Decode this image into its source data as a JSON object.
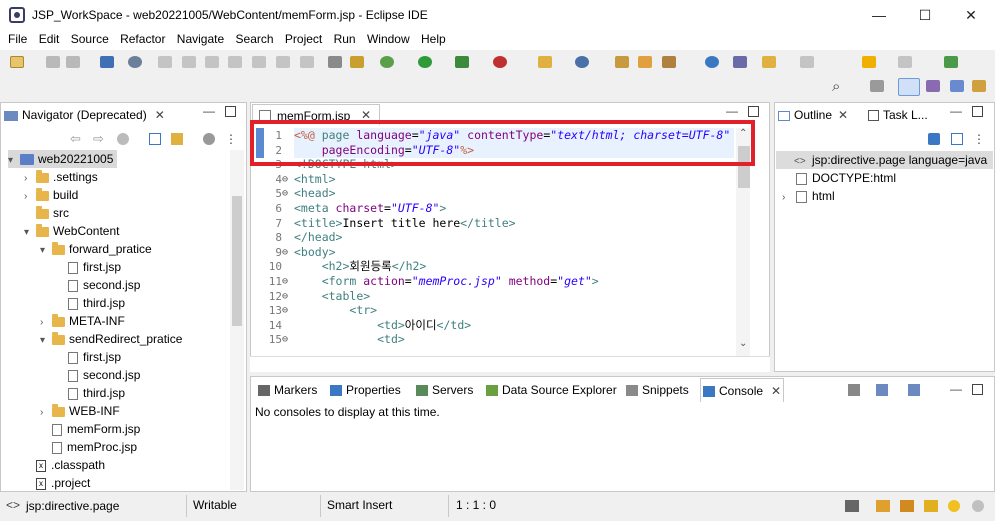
{
  "window": {
    "title": "JSP_WorkSpace - web20221005/WebContent/memForm.jsp - Eclipse IDE",
    "minimize": "—",
    "maximize": "☐",
    "close": "✕"
  },
  "menu": [
    "File",
    "Edit",
    "Source",
    "Refactor",
    "Navigate",
    "Search",
    "Project",
    "Run",
    "Window",
    "Help"
  ],
  "navigator": {
    "tab": "Navigator (Deprecated)",
    "items": [
      {
        "label": "web20221005",
        "kind": "project",
        "level": 0,
        "chevron": "▾"
      },
      {
        "label": ".settings",
        "kind": "folder",
        "level": 1,
        "chevron": "›"
      },
      {
        "label": "build",
        "kind": "folder",
        "level": 1,
        "chevron": "›"
      },
      {
        "label": "src",
        "kind": "folder",
        "level": 1,
        "chevron": ""
      },
      {
        "label": "WebContent",
        "kind": "folder",
        "level": 1,
        "chevron": "▾"
      },
      {
        "label": "forward_pratice",
        "kind": "folder",
        "level": 2,
        "chevron": "▾"
      },
      {
        "label": "first.jsp",
        "kind": "file",
        "level": 3,
        "chevron": ""
      },
      {
        "label": "second.jsp",
        "kind": "file",
        "level": 3,
        "chevron": ""
      },
      {
        "label": "third.jsp",
        "kind": "file",
        "level": 3,
        "chevron": ""
      },
      {
        "label": "META-INF",
        "kind": "folder",
        "level": 2,
        "chevron": "›"
      },
      {
        "label": "sendRedirect_pratice",
        "kind": "folder",
        "level": 2,
        "chevron": "▾"
      },
      {
        "label": "first.jsp",
        "kind": "file",
        "level": 3,
        "chevron": ""
      },
      {
        "label": "second.jsp",
        "kind": "file",
        "level": 3,
        "chevron": ""
      },
      {
        "label": "third.jsp",
        "kind": "file",
        "level": 3,
        "chevron": ""
      },
      {
        "label": "WEB-INF",
        "kind": "folder",
        "level": 2,
        "chevron": "›"
      },
      {
        "label": "memForm.jsp",
        "kind": "file",
        "level": 2,
        "chevron": ""
      },
      {
        "label": "memProc.jsp",
        "kind": "file",
        "level": 2,
        "chevron": ""
      },
      {
        "label": ".classpath",
        "kind": "xfile",
        "level": 1,
        "chevron": ""
      },
      {
        "label": ".project",
        "kind": "xfile",
        "level": 1,
        "chevron": ""
      }
    ]
  },
  "editor": {
    "tab": "memForm.jsp",
    "lines": [
      {
        "n": "1",
        "fold": "",
        "parts": [
          [
            "jsp",
            "<%@ "
          ],
          [
            "dir",
            "page "
          ],
          [
            "attr",
            "language"
          ],
          [
            "",
            "="
          ],
          [
            "val",
            "\"java\""
          ],
          [
            "",
            " "
          ],
          [
            "attr",
            "contentType"
          ],
          [
            "",
            "="
          ],
          [
            "val",
            "\"text/html; charset=UTF-8\""
          ]
        ]
      },
      {
        "n": "2",
        "fold": "",
        "parts": [
          [
            "",
            "    "
          ],
          [
            "attr",
            "pageEncoding"
          ],
          [
            "",
            "="
          ],
          [
            "val",
            "\"UTF-8\""
          ],
          [
            "jsp",
            "%>"
          ]
        ]
      },
      {
        "n": "3",
        "fold": "",
        "parts": [
          [
            "tag",
            "<!DOCTYPE html>"
          ]
        ]
      },
      {
        "n": "4",
        "fold": "⊖",
        "parts": [
          [
            "tag",
            "<html>"
          ]
        ]
      },
      {
        "n": "5",
        "fold": "⊖",
        "parts": [
          [
            "tag",
            "<head>"
          ]
        ]
      },
      {
        "n": "6",
        "fold": "",
        "parts": [
          [
            "tag",
            "<meta "
          ],
          [
            "attr",
            "charset"
          ],
          [
            "",
            "="
          ],
          [
            "val",
            "\"UTF-8\""
          ],
          [
            "tag",
            ">"
          ]
        ]
      },
      {
        "n": "7",
        "fold": "",
        "parts": [
          [
            "tag",
            "<title>"
          ],
          [
            "",
            "Insert title here"
          ],
          [
            "tag",
            "</title>"
          ]
        ]
      },
      {
        "n": "8",
        "fold": "",
        "parts": [
          [
            "tag",
            "</head>"
          ]
        ]
      },
      {
        "n": "9",
        "fold": "⊖",
        "parts": [
          [
            "tag",
            "<body>"
          ]
        ]
      },
      {
        "n": "10",
        "fold": "",
        "parts": [
          [
            "",
            "    "
          ],
          [
            "tag",
            "<h2>"
          ],
          [
            "",
            "회원등록"
          ],
          [
            "tag",
            "</h2>"
          ]
        ]
      },
      {
        "n": "11",
        "fold": "⊖",
        "parts": [
          [
            "",
            "    "
          ],
          [
            "tag",
            "<form "
          ],
          [
            "attr",
            "action"
          ],
          [
            "",
            "="
          ],
          [
            "val",
            "\"memProc.jsp\""
          ],
          [
            "",
            " "
          ],
          [
            "attr",
            "method"
          ],
          [
            "",
            "="
          ],
          [
            "val",
            "\"get\""
          ],
          [
            "tag",
            ">"
          ]
        ]
      },
      {
        "n": "12",
        "fold": "⊖",
        "parts": [
          [
            "",
            "    "
          ],
          [
            "tag",
            "<table>"
          ]
        ]
      },
      {
        "n": "13",
        "fold": "⊖",
        "parts": [
          [
            "",
            "        "
          ],
          [
            "tag",
            "<tr>"
          ]
        ]
      },
      {
        "n": "14",
        "fold": "",
        "parts": [
          [
            "",
            "            "
          ],
          [
            "tag",
            "<td>"
          ],
          [
            "",
            "아이디"
          ],
          [
            "tag",
            "</td>"
          ]
        ]
      },
      {
        "n": "15",
        "fold": "⊖",
        "parts": [
          [
            "",
            "            "
          ],
          [
            "tag",
            "<td>"
          ]
        ]
      }
    ]
  },
  "outline": {
    "tabs": [
      "Outline",
      "Task L..."
    ],
    "items": [
      {
        "label": "jsp:directive.page language=java",
        "chevron": "<>"
      },
      {
        "label": "DOCTYPE:html",
        "chevron": ""
      },
      {
        "label": "html",
        "chevron": "›"
      }
    ]
  },
  "bottom": {
    "tabs": [
      "Markers",
      "Properties",
      "Servers",
      "Data Source Explorer",
      "Snippets",
      "Console"
    ],
    "active": "Console",
    "message": "No consoles to display at this time."
  },
  "status": {
    "path": "jsp:directive.page",
    "mode": "Writable",
    "insert": "Smart Insert",
    "position": "1 : 1 : 0"
  },
  "colors": {
    "highlight": "#e0202a",
    "selection": "#1e7ad6"
  }
}
